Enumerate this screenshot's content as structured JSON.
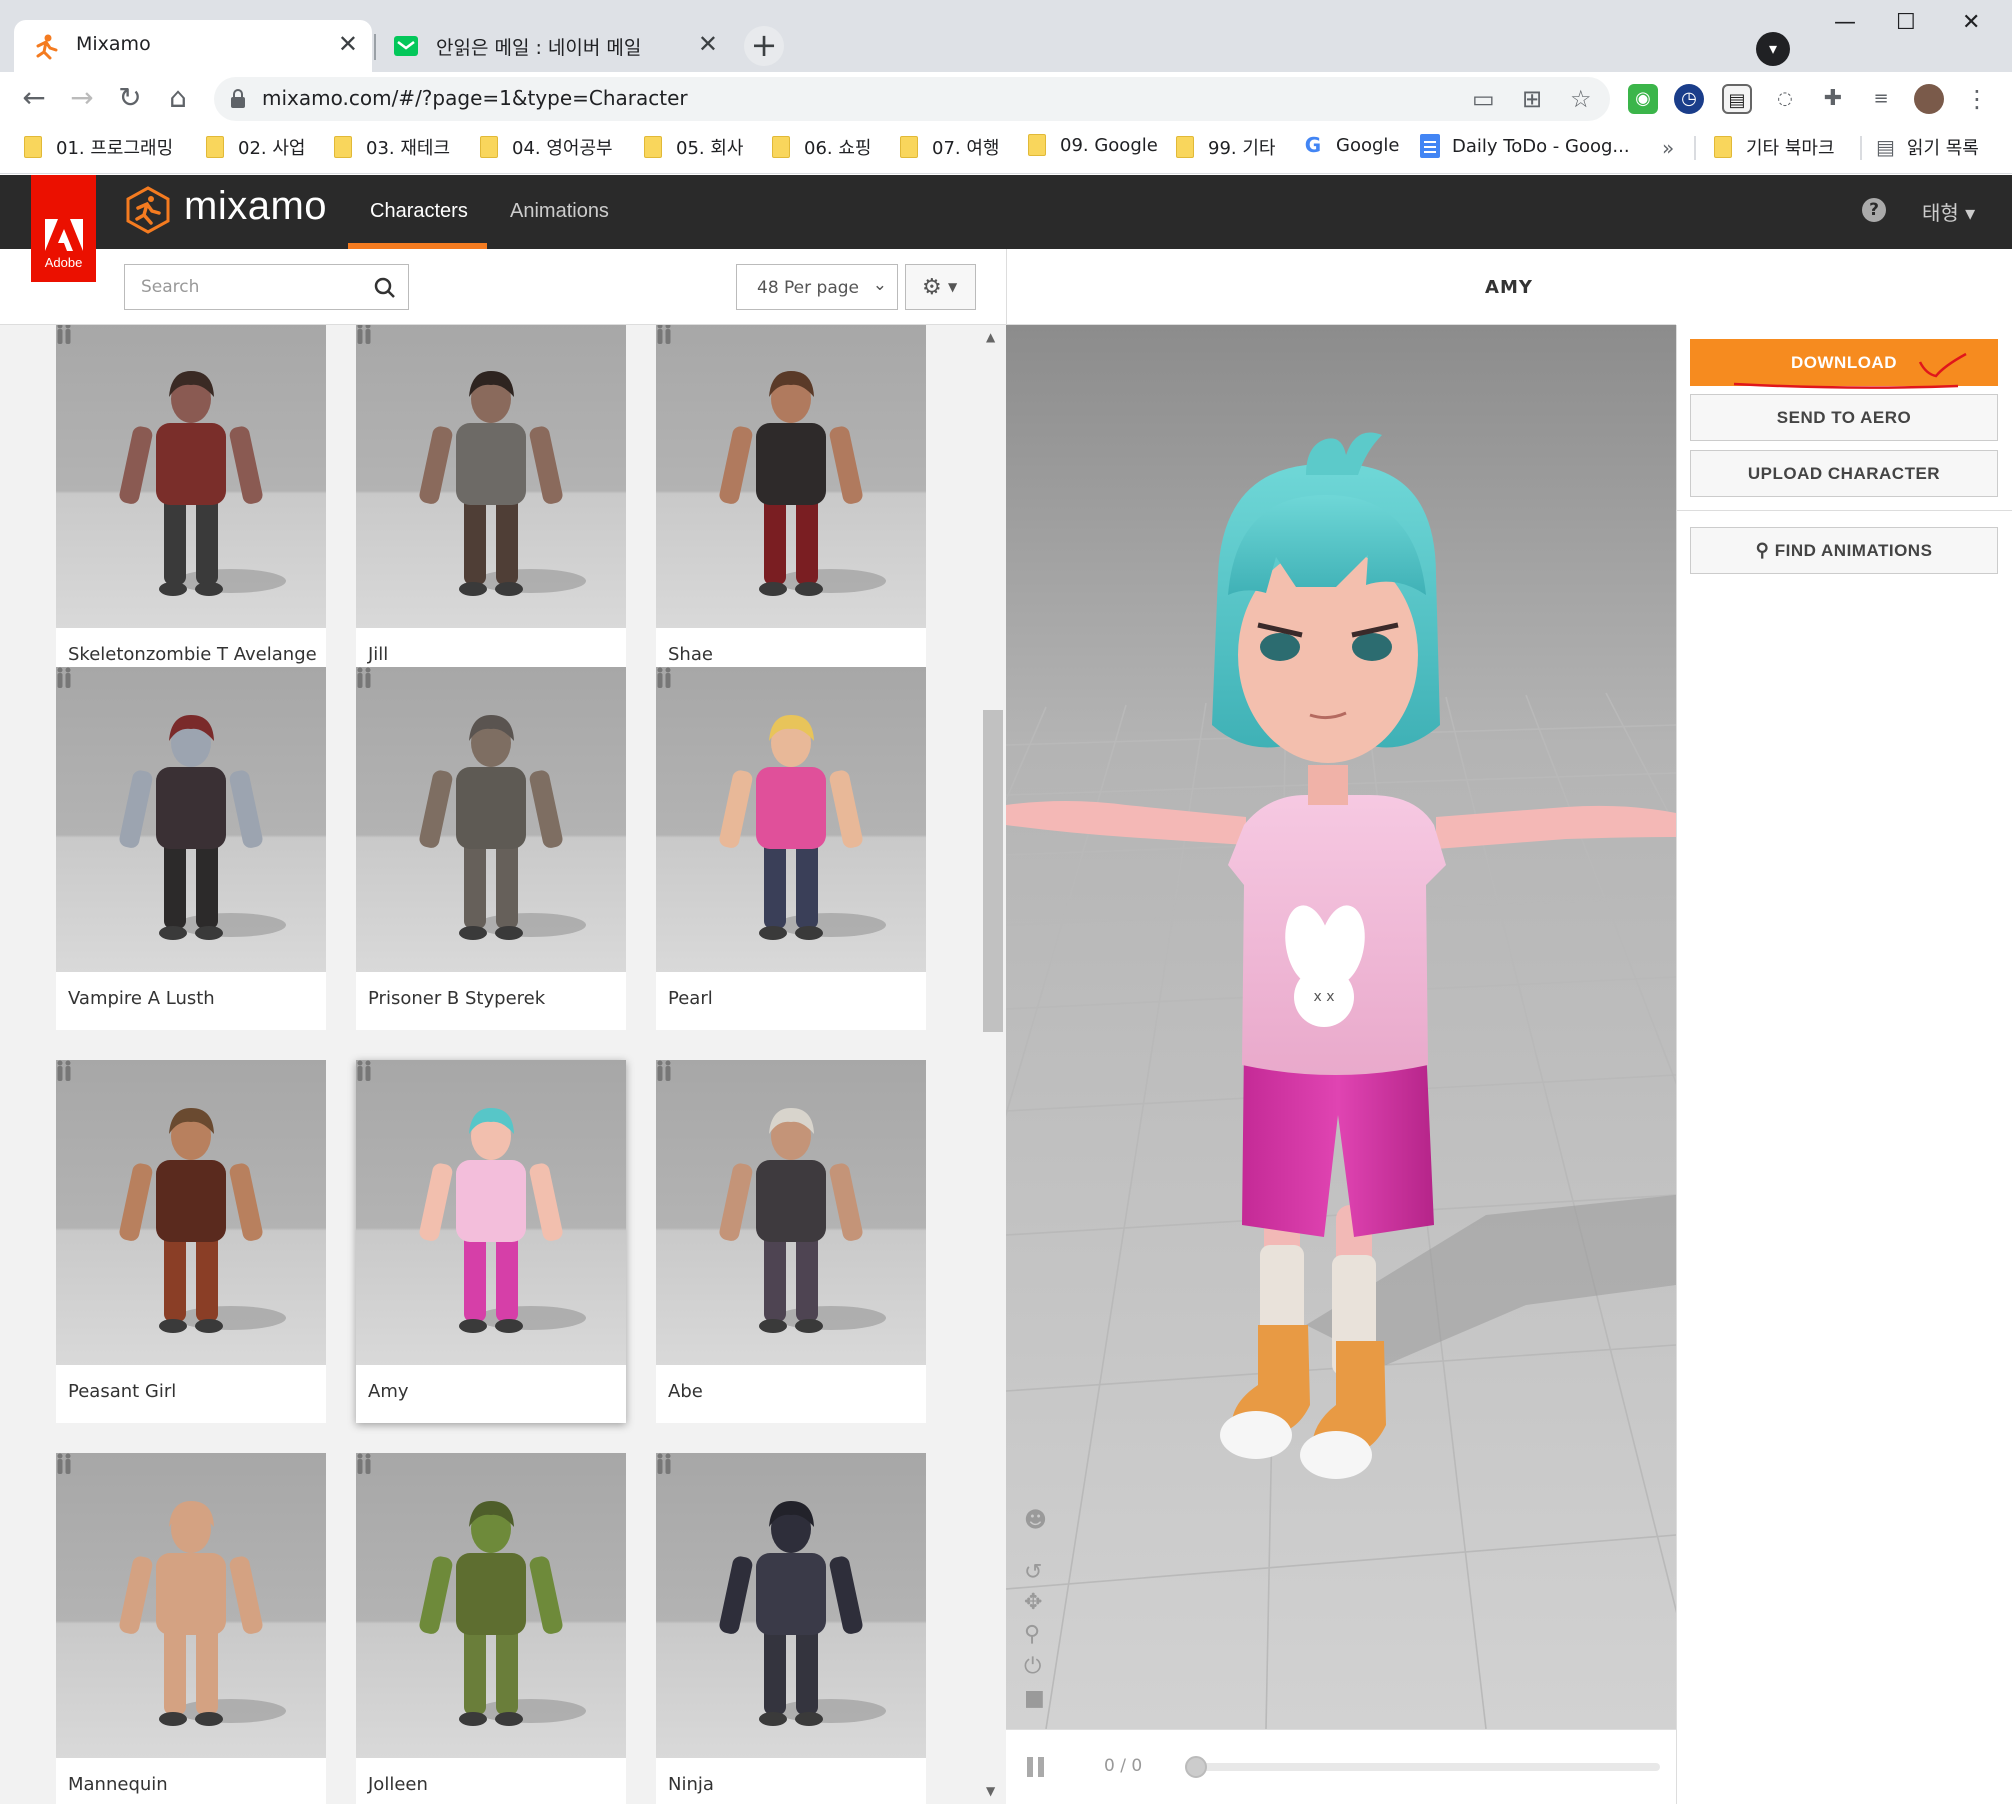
{
  "browser": {
    "tabs": [
      {
        "title": "Mixamo",
        "active": true
      },
      {
        "title": "안읽은 메일 : 네이버 메일",
        "active": false
      }
    ],
    "new_tab": "+",
    "close": "✕",
    "window": {
      "minimize": "—",
      "maximize": "☐",
      "close": "✕"
    },
    "url": "mixamo.com/#/?page=1&type=Character",
    "bookmarks": [
      "01. 프로그래밍",
      "02. 사업",
      "03. 재테크",
      "04. 영어공부",
      "05. 회사",
      "06. 쇼핑",
      "07. 여행",
      "09. Google",
      "99. 기타",
      "Google",
      "Daily ToDo - Goog..."
    ],
    "bookmarks_more": "»",
    "other_bookmarks": "기타 북마크",
    "reading_list": "읽기 목록"
  },
  "header": {
    "adobe": "Adobe",
    "logo": "mixamo",
    "nav": [
      "Characters",
      "Animations"
    ],
    "help": "?",
    "user": "태형 ▾"
  },
  "toolbar": {
    "search_placeholder": "Search",
    "per_page": "48 Per page"
  },
  "characters": [
    {
      "name": "Skeletonzombie T Avelange",
      "skin": "#8a5a52",
      "top": "#7a2e2a",
      "bottom": "#3a3a3a",
      "hair": "#3a2a24"
    },
    {
      "name": "Jill",
      "skin": "#8a6a5c",
      "top": "#6d6a66",
      "bottom": "#4f3e36",
      "hair": "#2e2420"
    },
    {
      "name": "Shae",
      "skin": "#b07a5e",
      "top": "#2e2a2a",
      "bottom": "#7a1e22",
      "hair": "#5a3a28"
    },
    {
      "name": "Vampire A Lusth",
      "skin": "#9ca4b0",
      "top": "#3a3034",
      "bottom": "#2c2a2a",
      "hair": "#7a2a2a"
    },
    {
      "name": "Prisoner B Styperek",
      "skin": "#7e6e62",
      "top": "#5e5a54",
      "bottom": "#66605a",
      "hair": "#5a5450"
    },
    {
      "name": "Pearl",
      "skin": "#e8b898",
      "top": "#e0509a",
      "bottom": "#3a3f58",
      "hair": "#e8c45a"
    },
    {
      "name": "Peasant Girl",
      "skin": "#b8805e",
      "top": "#5a2a1e",
      "bottom": "#8a3e26",
      "hair": "#6a4a30"
    },
    {
      "name": "Amy",
      "skin": "#f2bfae",
      "top": "#f3bedb",
      "bottom": "#d63fa8",
      "hair": "#57c6c8"
    },
    {
      "name": "Abe",
      "skin": "#c49478",
      "top": "#3e3a3e",
      "bottom": "#4e4452",
      "hair": "#d8d4cc"
    },
    {
      "name": "Mannequin",
      "skin": "#d4a282",
      "top": "#d4a282",
      "bottom": "#d4a282",
      "hair": "#d4a282"
    },
    {
      "name": "Jolleen",
      "skin": "#6e8a3a",
      "top": "#5e6e30",
      "bottom": "#6a7e3a",
      "hair": "#4e5e2a"
    },
    {
      "name": "Ninja",
      "skin": "#2e2e3a",
      "top": "#3a3a48",
      "bottom": "#34343e",
      "hair": "#22222a"
    }
  ],
  "selected_character": "Amy",
  "viewer": {
    "title": "AMY",
    "frame_counter": "0 / 0"
  },
  "actions": {
    "download": "DOWNLOAD",
    "send_to_aero": "SEND TO AERO",
    "upload_character": "UPLOAD CHARACTER",
    "find_animations": "FIND ANIMATIONS"
  },
  "colors": {
    "accent": "#f68b1f",
    "header_bg": "#2a2a2a",
    "adobe_red": "#eb1000"
  }
}
